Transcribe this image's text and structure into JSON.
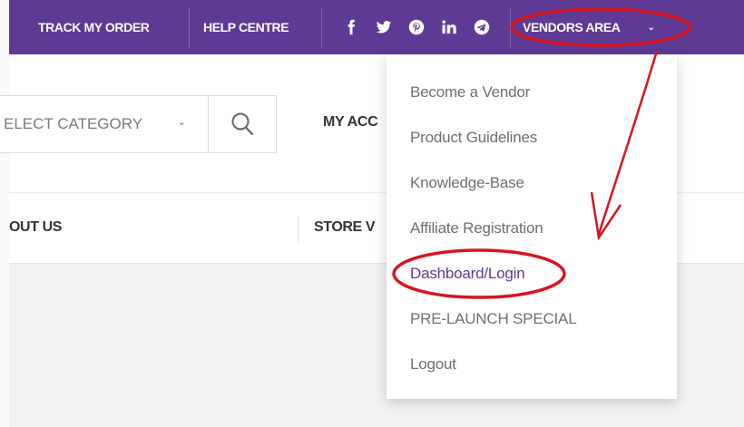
{
  "topbar": {
    "track_order": "TRACK MY ORDER",
    "help_centre": "HELP CENTRE",
    "vendors_area": "VENDORS AREA",
    "vendors_chevron": "⌄",
    "social_icons": [
      "facebook-icon",
      "twitter-icon",
      "pinterest-icon",
      "linkedin-icon",
      "telegram-icon"
    ]
  },
  "header": {
    "category_select": "ELECT CATEGORY",
    "category_chevron": "⌄",
    "search_icon": "search-icon",
    "my_account": "MY ACC"
  },
  "nav": {
    "about_us": "OUT US",
    "store_vendors": "STORE V"
  },
  "dropdown": {
    "items": [
      {
        "label": "Become a Vendor"
      },
      {
        "label": "Product Guidelines"
      },
      {
        "label": "Knowledge-Base"
      },
      {
        "label": "Affiliate Registration"
      },
      {
        "label": "Dashboard/Login"
      },
      {
        "label": "PRE-LAUNCH SPECIAL"
      },
      {
        "label": "Logout"
      }
    ]
  },
  "colors": {
    "brand_purple": "#5e3a94",
    "annotation_red": "#d8141e"
  }
}
